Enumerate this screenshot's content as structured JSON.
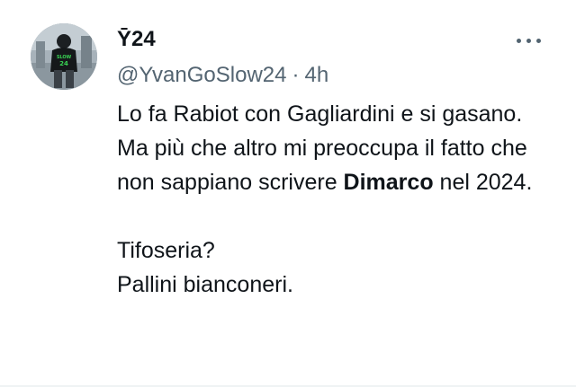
{
  "author": {
    "display_name": "Ȳ24",
    "handle": "@YvanGoSlow24",
    "separator": "·",
    "time": "4h",
    "avatar": "profile-photo",
    "avatar_lettering": [
      "SLOW",
      "24"
    ]
  },
  "more_icon": "more-horizontal-icon",
  "tweet": {
    "line1": "Lo fa Rabiot con Gagliardini e si gasano.",
    "line2": "Ma più che altro mi preoccupa il fatto che non sappiano scrivere",
    "line2_bold": "Dimarco",
    "line2_tail": " nel 2024.",
    "line3": "Tifoseria?",
    "line4": "Pallini bianconeri."
  },
  "colors": {
    "text_primary": "#0f1419",
    "text_secondary": "#536471",
    "background": "#ffffff",
    "avatar_accent": "#39d353"
  }
}
